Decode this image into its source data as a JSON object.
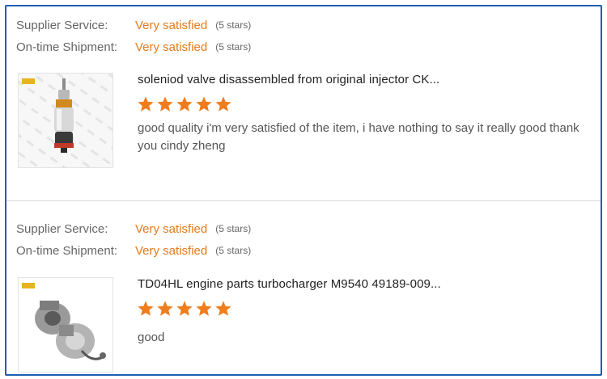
{
  "reviews": [
    {
      "supplier_service": {
        "label": "Supplier Service:",
        "value": "Very satisfied",
        "stars_text": "(5 stars)"
      },
      "shipment": {
        "label": "On-time Shipment:",
        "value": "Very satisfied",
        "stars_text": "(5 stars)"
      },
      "product_title": "soleniod valve disassembled from original injector CK...",
      "rating": 5,
      "comment": "good quality i'm very satisfied of the item, i have nothing to say it really good thank you cindy zheng"
    },
    {
      "supplier_service": {
        "label": "Supplier Service:",
        "value": "Very satisfied",
        "stars_text": "(5 stars)"
      },
      "shipment": {
        "label": "On-time Shipment:",
        "value": "Very satisfied",
        "stars_text": "(5 stars)"
      },
      "product_title": "TD04HL engine parts turbocharger M9540 49189-009...",
      "rating": 5,
      "comment": "good"
    }
  ],
  "colors": {
    "frame": "#1a5fb4",
    "accent": "#e57a1a",
    "star": "#f07c1c",
    "label": "#666666",
    "title": "#222222"
  },
  "icons": {
    "star": "star-icon"
  }
}
